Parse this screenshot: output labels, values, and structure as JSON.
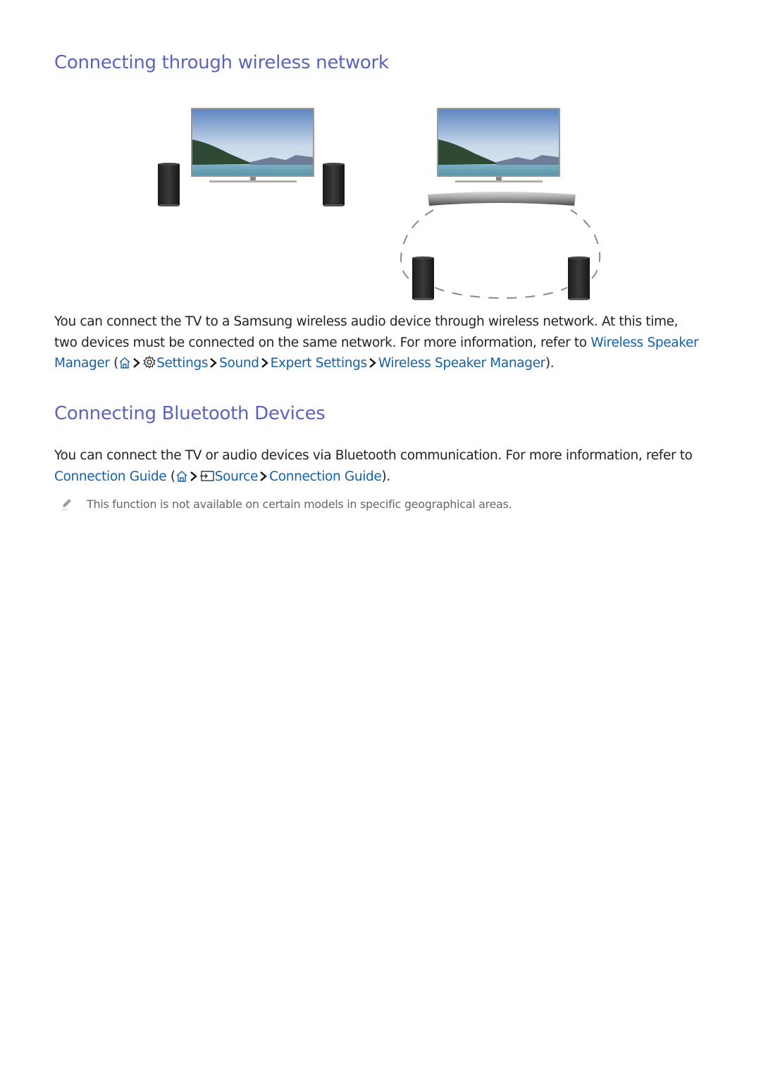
{
  "sections": {
    "wireless": {
      "heading": "Connecting through wireless network",
      "figure_alt_left": "TV with two wireless speakers",
      "figure_alt_right": "TV with curved soundbar and two wireless speakers connected wirelessly",
      "body_line1": "You can connect the TV to a Samsung wireless audio device through wireless network. At this time,",
      "body_line2_prefix": "two devices must be connected on the same network. For more information, refer to ",
      "link_title_part1": "Wireless Speaker",
      "link_title_part2": "Manager",
      "open_paren": " (",
      "path": {
        "settings": "Settings",
        "sound": "Sound",
        "expert": "Expert Settings",
        "target": "Wireless Speaker Manager"
      },
      "close": ")."
    },
    "bluetooth": {
      "heading": "Connecting Bluetooth Devices",
      "body_line1": "You can connect the TV or audio devices via Bluetooth communication. For more information, refer to",
      "link_title": "Connection Guide",
      "open_paren": " (",
      "path": {
        "source": "Source",
        "target": "Connection Guide"
      },
      "close": ")."
    },
    "note": {
      "text": "This function is not available on certain models in specific geographical areas."
    }
  },
  "colors": {
    "heading": "#5b63c0",
    "link": "#1460aa",
    "body": "#222222",
    "note": "#666666"
  }
}
